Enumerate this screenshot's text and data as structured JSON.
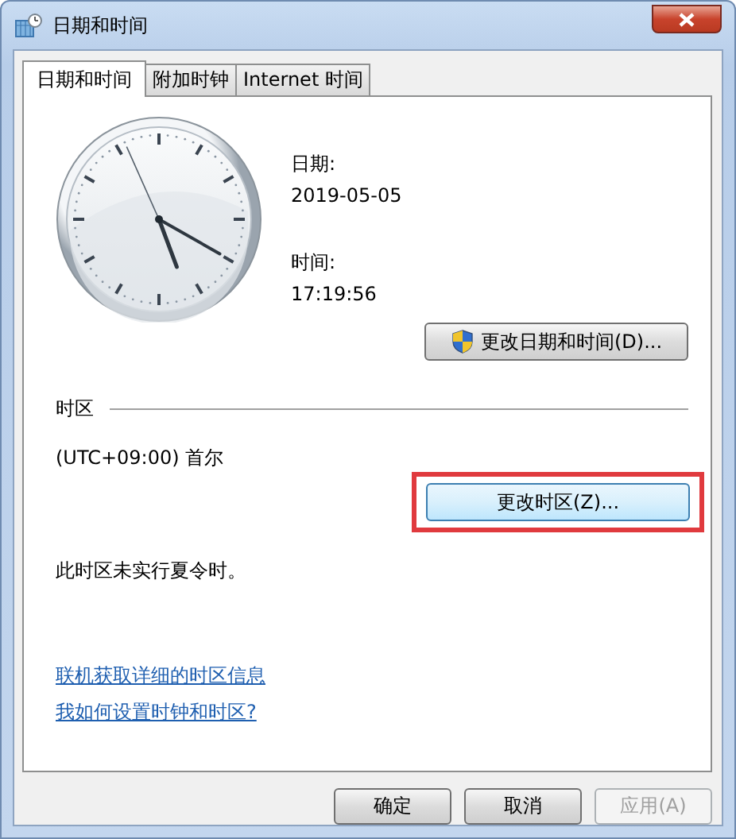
{
  "window": {
    "title": "日期和时间"
  },
  "tabs": [
    {
      "label": "日期和时间",
      "selected": true
    },
    {
      "label": "附加时钟",
      "selected": false
    },
    {
      "label": "Internet 时间",
      "selected": false
    }
  ],
  "date": {
    "label": "日期:",
    "value": "2019-05-05"
  },
  "time": {
    "label": "时间:",
    "value": "17:19:56"
  },
  "change_datetime_button": "更改日期和时间(D)...",
  "timezone": {
    "heading": "时区",
    "value": "(UTC+09:00) 首尔",
    "button": {
      "label": "更改时区(Z)...",
      "highlighted": true
    },
    "dst_note": "此时区未实行夏令时。"
  },
  "links": [
    "联机获取详细的时区信息",
    "我如何设置时钟和时区?"
  ],
  "buttons": [
    {
      "label": "确定",
      "disabled": false
    },
    {
      "label": "取消",
      "disabled": false
    },
    {
      "label": "应用(A)",
      "disabled": true
    }
  ]
}
